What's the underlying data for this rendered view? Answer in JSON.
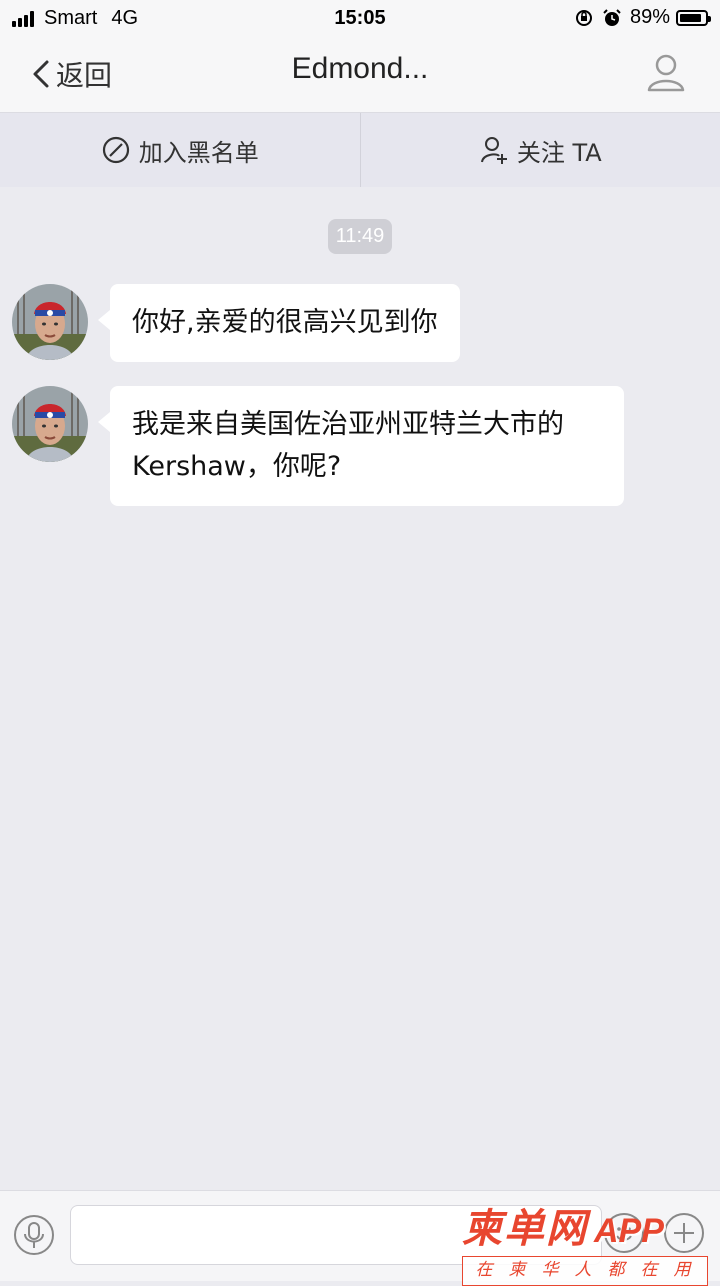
{
  "status_bar": {
    "carrier": "Smart",
    "network": "4G",
    "time": "15:05",
    "battery_percent": "89%",
    "battery_level": 0.89
  },
  "nav": {
    "back_label": "返回",
    "title": "Edmond..."
  },
  "actions": {
    "blacklist_label": "加入黑名单",
    "follow_label": "关注 TA"
  },
  "chat": {
    "timestamp": "11:49",
    "messages": [
      {
        "text": "你好,亲爱的很高兴见到你"
      },
      {
        "text": "我是来自美国佐治亚州亚特兰大市的 Kershaw，你呢?"
      }
    ]
  },
  "input": {
    "placeholder": ""
  },
  "watermark": {
    "title": "柬单网",
    "suffix": "APP",
    "tagline": "在柬华人都在用"
  },
  "colors": {
    "background": "#ebebf0",
    "watermark_red": "#e8462f"
  }
}
